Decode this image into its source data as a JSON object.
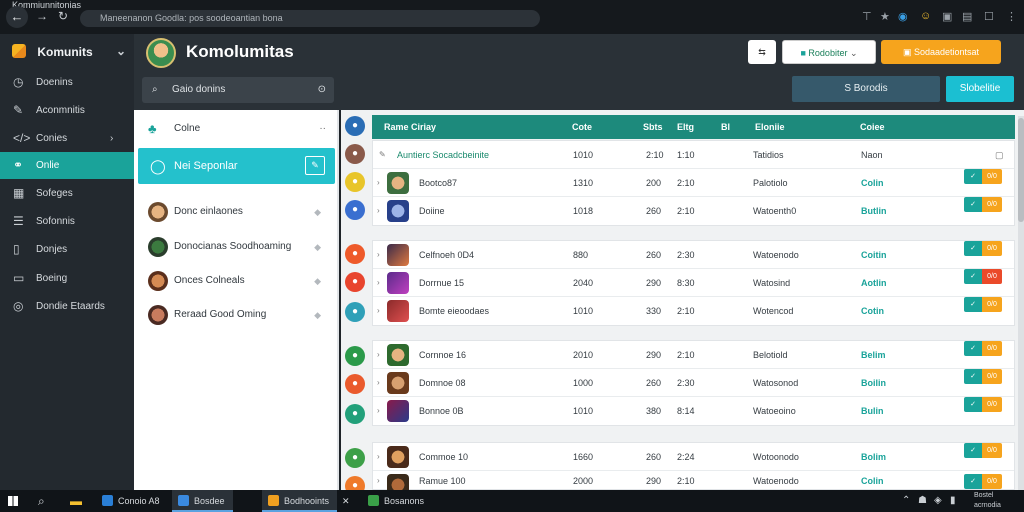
{
  "browser": {
    "tab_title": "Kommiunnitonias",
    "url": "Maneenanon Goodla: pos soodeoantian bona",
    "back_icon": "arrow-left-icon"
  },
  "sidebar": {
    "brand": "Komunits",
    "items": [
      {
        "label": "Doenins",
        "icon": "dashboard-icon"
      },
      {
        "label": "Aconmnitis",
        "icon": "wrench-icon"
      },
      {
        "label": "Conies",
        "icon": "code-icon"
      },
      {
        "label": "Onlie",
        "icon": "link-icon"
      },
      {
        "label": "Sofeges",
        "icon": "grid-icon"
      },
      {
        "label": "Sofonnis",
        "icon": "list-icon"
      },
      {
        "label": "Donjes",
        "icon": "file-icon"
      },
      {
        "label": "Boeing",
        "icon": "folder-icon"
      },
      {
        "label": "Dondie Etaards",
        "icon": "globe-icon"
      }
    ]
  },
  "header": {
    "title": "Komolumitas",
    "search_placeholder": "Gaio donins",
    "btn_icon_label": "⇆",
    "btn_white_label": "Rodobiter",
    "btn_orange_label": "Sodaadetiontsat",
    "btn_dark_label": "S Borodis",
    "btn_teal_label": "Slobelitie"
  },
  "left_panel": {
    "header": "Colne",
    "active": "Nei Seponlar",
    "items": [
      "Donc einlaones",
      "Donocianas Soodhoaming",
      "Onces Colneals",
      "Reraad Good Oming"
    ]
  },
  "table": {
    "headers": [
      "Rame Ciriay",
      "Cote",
      "Sbts",
      "Eltg",
      "Bl",
      "Eloniie",
      "Coiee"
    ],
    "first_row": {
      "name": "Auntierc Socadcbeinite",
      "c1": "1010",
      "c2": "2:10",
      "c3": "1:10",
      "c4": "Tatidios",
      "c5": "Naon"
    },
    "groups": [
      {
        "rows": [
          {
            "name": "Bootco87",
            "c1": "1310",
            "c2": "200",
            "c3": "2:10",
            "c4": "Palotiolo",
            "status": "Colin",
            "right": "0/0"
          },
          {
            "name": "Doiine",
            "c1": "1018",
            "c2": "260",
            "c3": "2:10",
            "c4": "Watoenth0",
            "status": "Butlin",
            "right": "0/0"
          }
        ]
      },
      {
        "rows": [
          {
            "name": "Celfnoeh 0D4",
            "c1": "880",
            "c2": "260",
            "c3": "2:30",
            "c4": "Watoenodo",
            "status": "Coitin",
            "right": "0/0"
          },
          {
            "name": "Dorrnue 15",
            "c1": "2040",
            "c2": "290",
            "c3": "8:30",
            "c4": "Watosind",
            "status": "Aotlin",
            "right": "0/0"
          },
          {
            "name": "Bomte eieoodaes",
            "c1": "1010",
            "c2": "330",
            "c3": "2:10",
            "c4": "Wotencod",
            "status": "Cotin",
            "right": "0/0"
          }
        ]
      },
      {
        "rows": [
          {
            "name": "Cornnoe 16",
            "c1": "2010",
            "c2": "290",
            "c3": "2:10",
            "c4": "Belotiold",
            "status": "Belim",
            "right": "0/0"
          },
          {
            "name": "Domnoe 08",
            "c1": "1000",
            "c2": "260",
            "c3": "2:30",
            "c4": "Watosonod",
            "status": "Boilin",
            "right": "0/0"
          },
          {
            "name": "Bonnoe 0B",
            "c1": "1010",
            "c2": "380",
            "c3": "8:14",
            "c4": "Watoeoino",
            "status": "Bulin",
            "right": "0/0"
          }
        ]
      },
      {
        "rows": [
          {
            "name": "Commoe 10",
            "c1": "1660",
            "c2": "260",
            "c3": "2:24",
            "c4": "Wotoonodo",
            "status": "Bolim",
            "right": "0/0"
          },
          {
            "name": "Ramue 100",
            "c1": "2000",
            "c2": "290",
            "c3": "2:10",
            "c4": "Watoenodo",
            "status": "Colin",
            "right": "0/0"
          }
        ]
      }
    ]
  },
  "taskbar": {
    "items": [
      "Conoio A8",
      "Bosdee",
      "Bodhooints",
      "Bosanons"
    ],
    "tray": [
      "Bostel",
      "acrnodia"
    ]
  },
  "colors": {
    "accent": "#1aa39a",
    "header_teal": "#1d8a7c",
    "cyan": "#24c1cc",
    "orange": "#f6a41d",
    "dark_blue": "#36596b"
  }
}
